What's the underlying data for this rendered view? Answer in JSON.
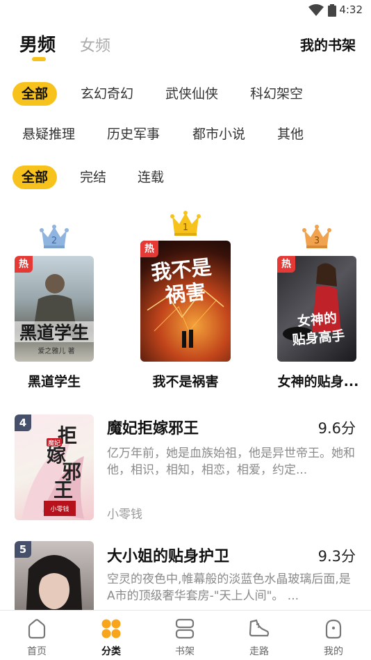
{
  "status": {
    "time": "4:32"
  },
  "header": {
    "tab_active": "男频",
    "tab_inactive": "女频",
    "shelf": "我的书架"
  },
  "filters": {
    "genres": [
      "全部",
      "玄幻奇幻",
      "武侠仙侠",
      "科幻架空",
      "悬疑推理",
      "历史军事",
      "都市小说",
      "其他"
    ],
    "status": [
      "全部",
      "完结",
      "连载"
    ]
  },
  "ranking": [
    {
      "rank": "2",
      "title": "黑道学生",
      "badge": "热",
      "cover_text": "黑道学生",
      "cover_author": "爱之雅儿 著"
    },
    {
      "rank": "1",
      "title": "我不是祸害",
      "badge": "热",
      "cover_text": "我不是祸害"
    },
    {
      "rank": "3",
      "title": "女神的贴身...",
      "badge": "热",
      "cover_text": "女神的贴身高手"
    }
  ],
  "list": [
    {
      "num": "4",
      "title": "魔妃拒嫁邪王",
      "score": "9.6分",
      "desc": "亿万年前，她是血族始祖，他是异世帝王。她和他，相识，相知，相恋，相爱，约定...",
      "author": "小零钱",
      "cover_text": "拒嫁邪王",
      "cover_small": "魔妃",
      "cover_author": "小零钱"
    },
    {
      "num": "5",
      "title": "大小姐的贴身护卫",
      "score": "9.3分",
      "desc": "空灵的夜色中,帷幕般的淡蓝色水晶玻璃后面,是A市的顶级奢华套房-\"天上人间\"。 ...",
      "author": ""
    }
  ],
  "nav": [
    {
      "label": "首页",
      "icon": "home-icon"
    },
    {
      "label": "分类",
      "icon": "category-icon"
    },
    {
      "label": "书架",
      "icon": "bookshelf-icon"
    },
    {
      "label": "走路",
      "icon": "shoe-icon"
    },
    {
      "label": "我的",
      "icon": "profile-icon"
    }
  ],
  "colors": {
    "accent": "#f8c21c",
    "hot": "#e53935",
    "rank_badge": "#47506a"
  }
}
